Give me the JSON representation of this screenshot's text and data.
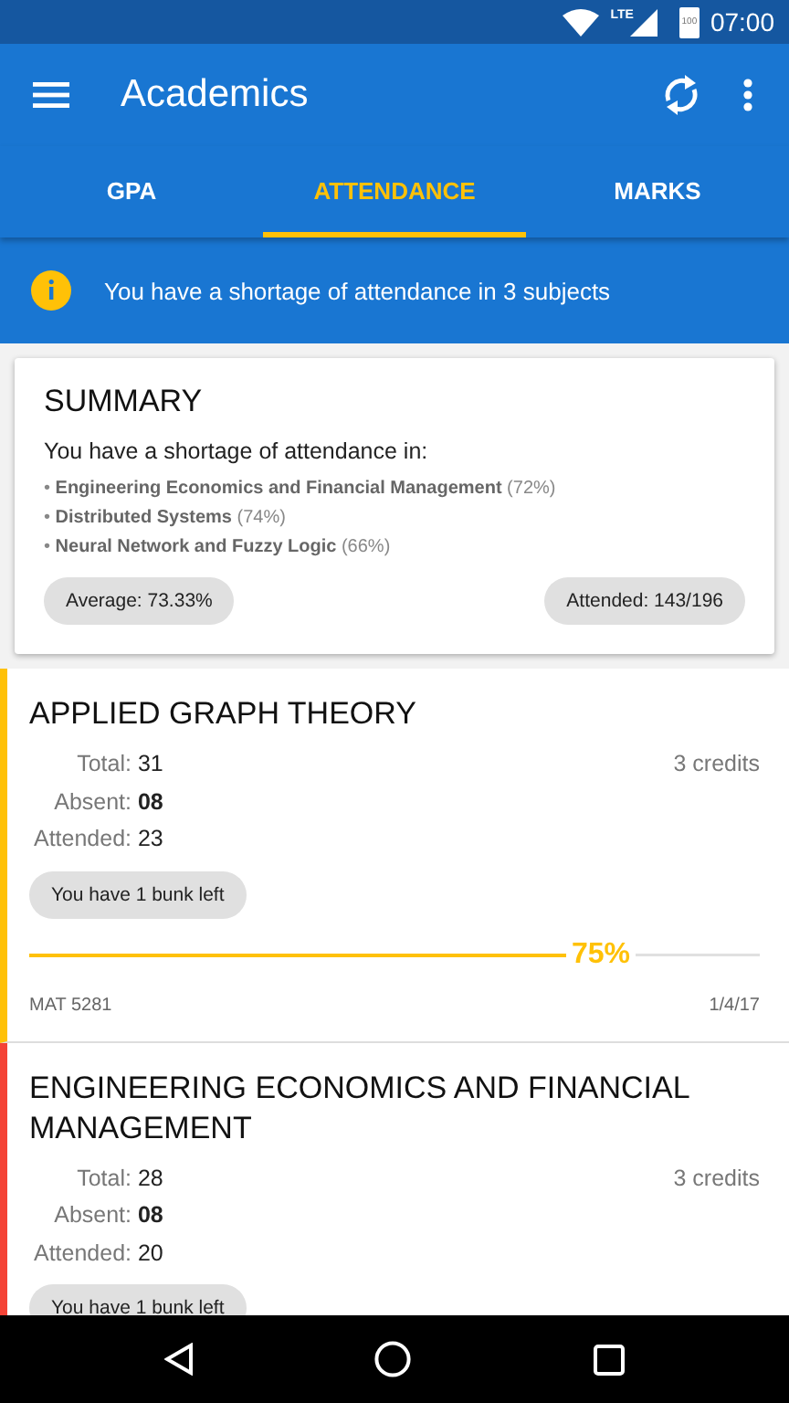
{
  "status_bar": {
    "network": "LTE",
    "battery": "100",
    "time": "07:00"
  },
  "app_bar": {
    "title": "Academics"
  },
  "tabs": [
    {
      "label": "GPA",
      "selected": false
    },
    {
      "label": "ATTENDANCE",
      "selected": true
    },
    {
      "label": "MARKS",
      "selected": false
    }
  ],
  "banner": {
    "text": "You have a shortage of attendance in 3 subjects"
  },
  "summary": {
    "title": "SUMMARY",
    "intro": "You have a shortage of attendance in:",
    "items": [
      "• **Engineering Economics and Financial Management** (72%)",
      "• **Distributed Systems** (74%)",
      "• **Neural Network and Fuzzy Logic** (66%)"
    ],
    "average": "Average: 73.33%",
    "attended": "Attended: 143/196"
  },
  "subjects": [
    {
      "title": "APPLIED GRAPH THEORY",
      "color": "#ffc107",
      "stats": [
        {
          "label": "Total:",
          "value": "31",
          "bold": false
        },
        {
          "label": "Absent:",
          "value": "08",
          "bold": true
        },
        {
          "label": "Attended:",
          "value": "23",
          "bold": false
        }
      ],
      "credits": "3 credits",
      "chip": "You have 1 bunk left",
      "level": 0.75,
      "percent": "75%",
      "code": "MAT 5281",
      "date": "1/4/17"
    },
    {
      "title": "ENGINEERING ECONOMICS AND FINANCIAL MANAGEMENT",
      "color": "#f44336",
      "stats": [
        {
          "label": "Total:",
          "value": "28",
          "bold": false
        },
        {
          "label": "Absent:",
          "value": "08",
          "bold": true
        },
        {
          "label": "Attended:",
          "value": "20",
          "bold": false
        }
      ],
      "credits": "3 credits",
      "chip": "You have 1 bunk left"
    }
  ]
}
